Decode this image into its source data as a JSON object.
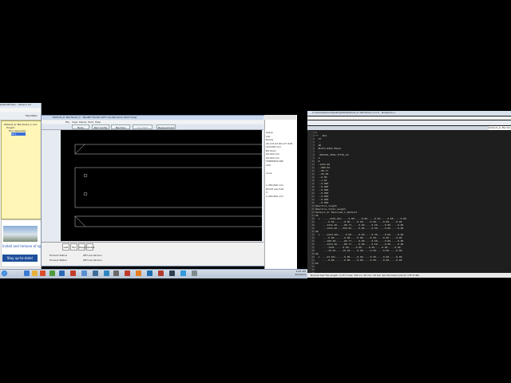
{
  "postcam": {
    "title": "PostCAM Dev - Version 10",
    "toolbar_label": "MachPath",
    "tree": [
      "Default_Ar Machined_C.nc2",
      "Project",
      "Tool Assembly",
      "Mi 1"
    ],
    "news_headline": "Install and remove of rgs",
    "stay_label": "Stay up-to-date!"
  },
  "nc_viewer": {
    "title": "Default_Ar Machined_C - NeoMill Studio DXF Line Renderer (Part View)",
    "menu": [
      "File",
      "View",
      "Pieces",
      "Tools",
      "Help"
    ],
    "tabs": [
      "Body",
      "Part Config",
      "Machine System",
      "Tool Path Params",
      "Measurement"
    ],
    "bottom_buttons": [
      "Left",
      "Top",
      "Height",
      "Vertex"
    ],
    "bottom_labels": [
      "Product Status",
      "Process Status",
      "Off Line Version",
      "Off Line Version"
    ]
  },
  "property_panel": {
    "items": [
      "Setup",
      "Lab",
      "Ready",
      "30,133,97,80,277,636",
      "200,800 mm",
      "Bit Diam",
      "60,000 mm",
      "40,000 mm",
      "TEMPERATURE",
      "100",
      "none",
      "1,456,890 mm",
      "NVCM Lab Dist",
      "3",
      "1,456,890 mm"
    ]
  },
  "taskbar": {
    "clock_time": "9:22 AM",
    "clock_date": "2/5/2014"
  },
  "notepad": {
    "title": "C:\\Users\\Admin\\Desktop\\NC\\Default_Ar Machined_C.nc2 - Notepad++",
    "active_tab": "Default_Ar Machined",
    "code_lines": [
      "%",
      "**  .NC1",
      "",
      "  ST",
      "",
      "  --",
      "  AK",
      "  NLOTA NIOA HOpel",
      "  --",
      "  -SMCZ32_4F40_TTF10_AS",
      "  A",
      "  R",
      "  -1234.66",
      "  --800.02",
      "  --90.77",
      "  --50.00",
      "  --0.00",
      "  --1.62",
      "  --0.000",
      "  --0.000",
      "  --0.000",
      "  --0.000",
      "  --0.000",
      "  --0.000",
      "  --0.000",
      "",
      "@Section_length",
      "",
      "@Section_total_weight",
      "Default_Ar Machined_C_Default",
      "AK",
      "  o  .....1234.66v.....0.00.....0.00.....0.50.....0.00.....0.00",
      "     ....0.00.......0.00.....0.00.....0.50.....0.00.....0.00",
      "     ..-1234.46....-80.77.....0.00.....0.50.....0.00.....0.00",
      "     ..-1234.46...-550.66.....0.00.....0.50.....0.00.....0.00",
      "AK",
      "  o  ..-1234.46v.....0.00.....0.00.....0.50.....0.00.....0.00",
      "     ....0.00.......0.00.....0.00.....0.50.....0.00.....0.00",
      "     ..-100.00.....-80.77.....0.00.....0.50.....0.00.....0.00",
      "     ..-1234.46....-80.77.....0.00.....0.50.....0.00.....0.00",
      "     ...-1234......0.00.....0.00.....0.50.....0.00.....0.00",
      "     ...-19.94....-19.94.....0.00.....0.50.....0.00.....0.00",
      "AK",
      "  o  ..-43.65v......0.00.....0.00.....0.50.....0.00.....0.00",
      "     ....0.00.......0.00.....0.00.....0.50.....0.00.....0.00",
      "ED"
    ],
    "status": "Normal text file     length: 2,757   lines: 100     Ln: 26   Col: 18   Sel: 0|0     Windows (CR LF)   UTF-8   INS"
  },
  "colors": {
    "canvas_bg": "#000000",
    "tree_bg": "#fff6b8",
    "editor_bg": "#1e1e1e"
  }
}
